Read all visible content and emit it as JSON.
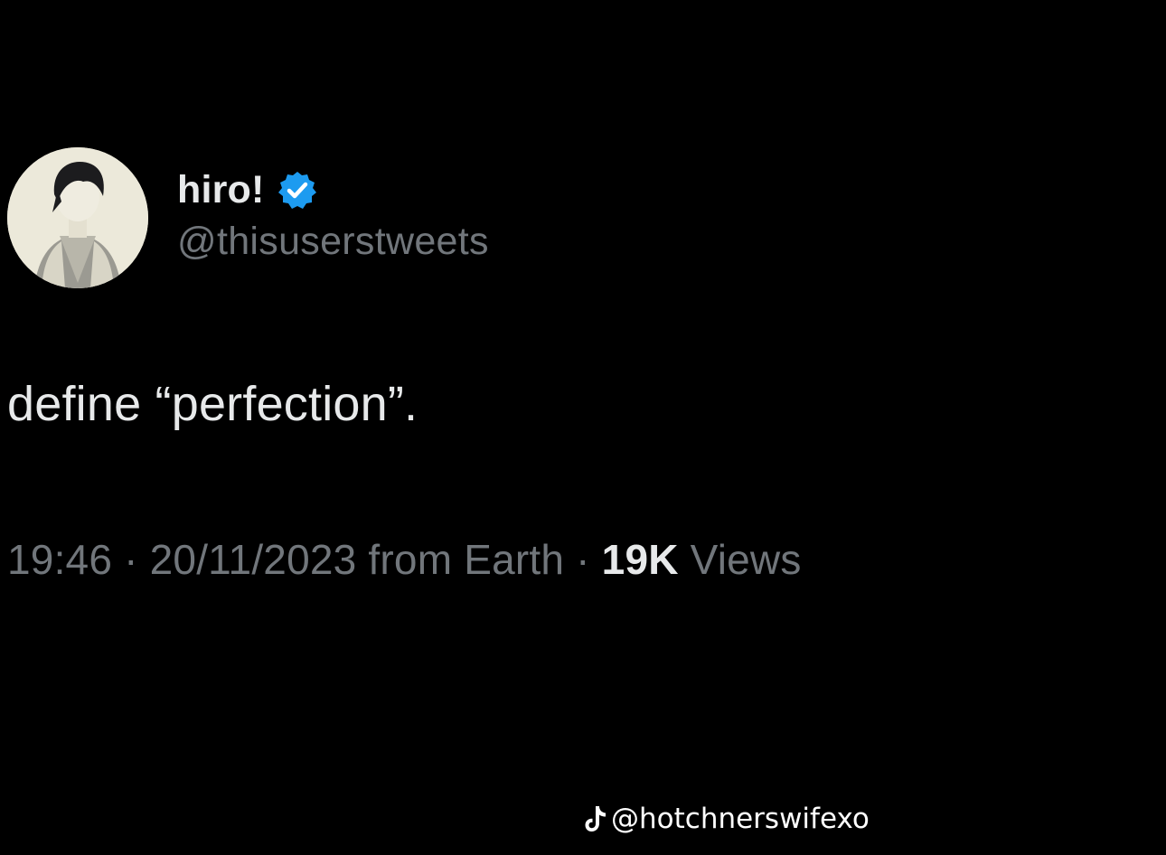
{
  "tweet": {
    "display_name": "hiro!",
    "handle": "@thisuserstweets",
    "text": "define “perfection”.",
    "time": "19:46",
    "separator": "·",
    "date": "20/11/2023",
    "source": "from Earth",
    "views_count": "19K",
    "views_label": "Views"
  },
  "icons": {
    "avatar": "avatar-image",
    "verified": "verified-badge-icon",
    "watermark": "tiktok-icon"
  },
  "watermark": {
    "username": "@hotchnerswifexo"
  },
  "colors": {
    "background": "#000000",
    "primary_text": "#e7e9ea",
    "secondary_text": "#71767b",
    "verified_blue": "#1d9bf0"
  }
}
